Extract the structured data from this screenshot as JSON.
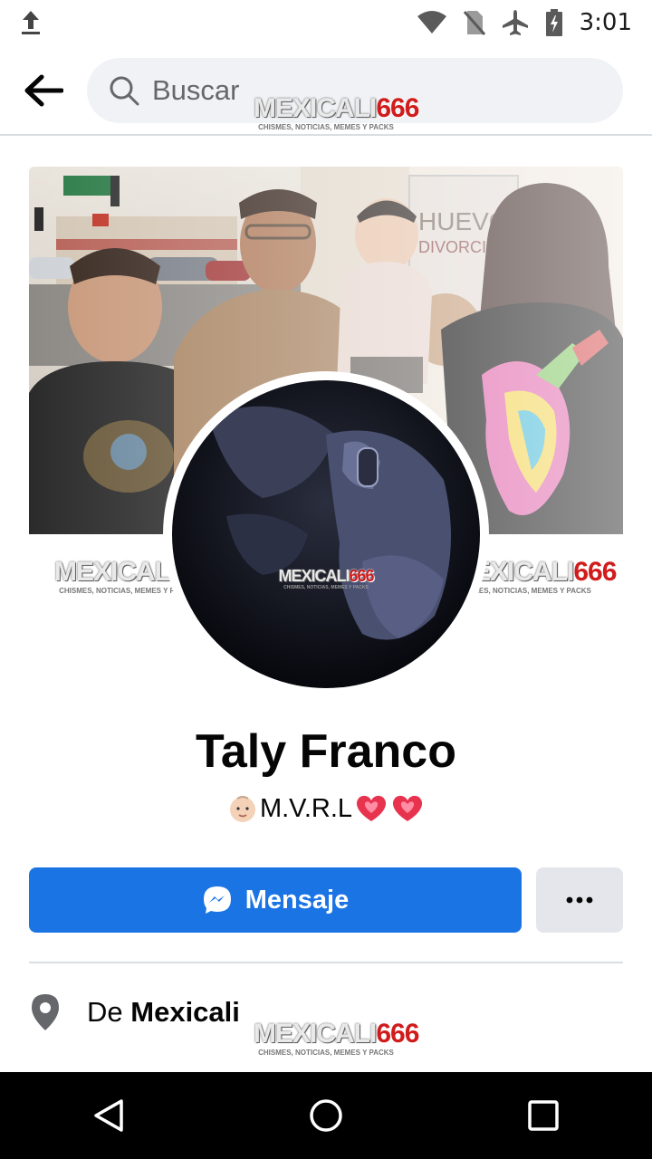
{
  "status_bar": {
    "time": "3:01",
    "icons": [
      "upload-icon",
      "wifi-icon",
      "no-sim-icon",
      "airplane-icon",
      "battery-icon"
    ]
  },
  "header": {
    "back_icon": "arrow-left-icon",
    "search_placeholder": "Buscar"
  },
  "watermark": {
    "brand_a": "MEXICALI",
    "brand_b": "666",
    "tagline": "CHISMES, NOTICIAS, MEMES Y PACKS"
  },
  "profile": {
    "name": "Taly Franco",
    "bio_text": "M.V.R.L"
  },
  "actions": {
    "message_label": "Mensaje",
    "more_label": "•••"
  },
  "intro": {
    "location_prefix": "De",
    "location_value": "Mexicali"
  },
  "colors": {
    "primary_button": "#1b74e4",
    "secondary_button": "#e4e6eb",
    "search_bg": "#f0f2f5",
    "watermark_red": "#d01c1c"
  },
  "nav": [
    "back-triangle-icon",
    "home-circle-icon",
    "recents-square-icon"
  ]
}
